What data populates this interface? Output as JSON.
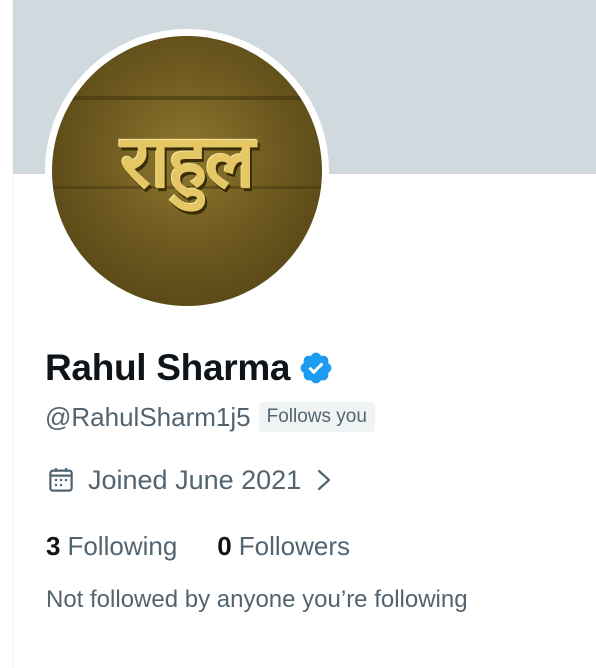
{
  "profile": {
    "avatar_text": "राहुल",
    "display_name": "Rahul Sharma",
    "handle": "@RahulSharm1j5",
    "follows_you_badge": "Follows you",
    "joined": "Joined June 2021",
    "following_count": "3",
    "following_label": "Following",
    "followers_count": "0",
    "followers_label": "Followers",
    "mutuals_text": "Not followed by anyone you’re following"
  },
  "icons": {
    "verified": "verified-badge-icon",
    "calendar": "calendar-icon",
    "chevron": "chevron-right-icon"
  },
  "colors": {
    "banner": "#cfd9de",
    "verified": "#1d9bf0",
    "secondary_text": "#536471",
    "primary_text": "#0f1419"
  }
}
